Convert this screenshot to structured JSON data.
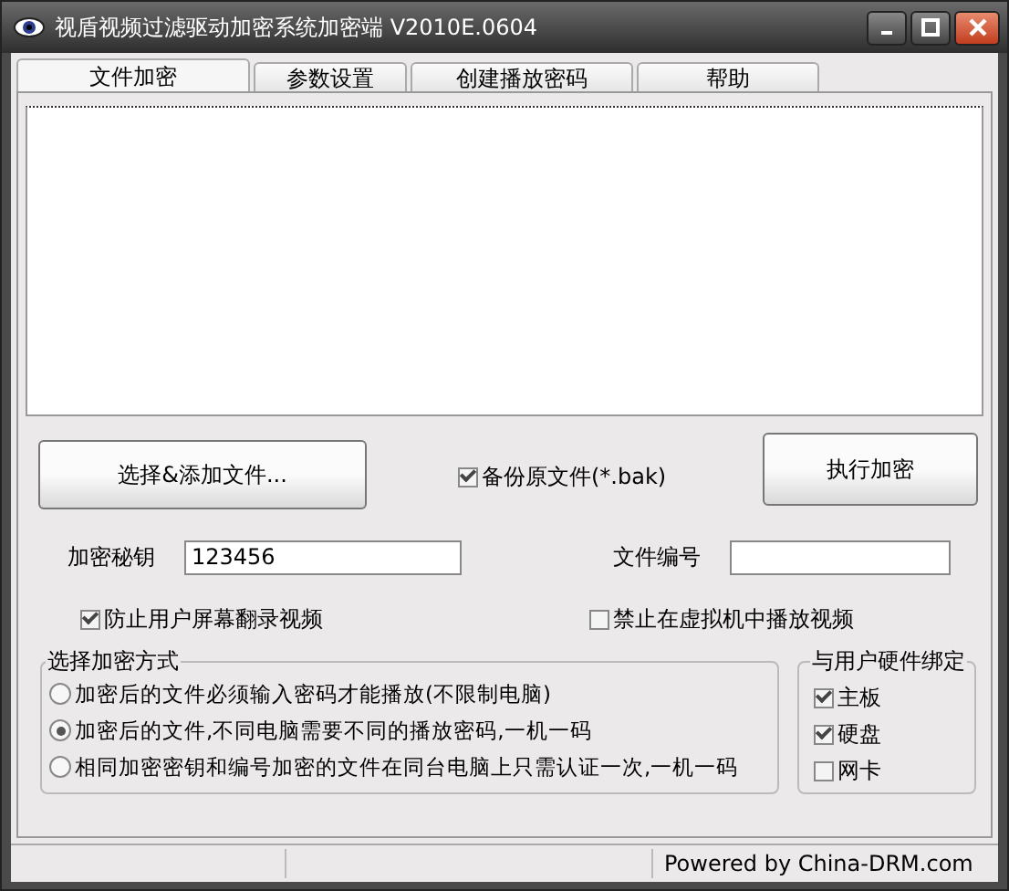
{
  "window": {
    "title": "视盾视频过滤驱动加密系统加密端 V2010E.0604"
  },
  "tabs": [
    {
      "label": "文件加密",
      "selected": true
    },
    {
      "label": "参数设置",
      "selected": false
    },
    {
      "label": "创建播放密码",
      "selected": false
    },
    {
      "label": "帮助",
      "selected": false
    }
  ],
  "add_button": "选择&添加文件...",
  "backup": {
    "label": "备份原文件(*.bak)",
    "checked": true
  },
  "encrypt_button": "执行加密",
  "key_field": {
    "label": "加密秘钥",
    "value": "123456"
  },
  "number_field": {
    "label": "文件编号"
  },
  "prevent_capture": {
    "label": "防止用户屏幕翻录视频",
    "checked": true
  },
  "block_vm": {
    "label": "禁止在虚拟机中播放视频",
    "checked": false
  },
  "mode_group": {
    "title": "选择加密方式",
    "options": [
      {
        "label": "加密后的文件必须输入密码才能播放(不限制电脑)",
        "selected": false
      },
      {
        "label": "加密后的文件,不同电脑需要不同的播放密码,一机一码",
        "selected": true
      },
      {
        "label": "相同加密密钥和编号加密的文件在同台电脑上只需认证一次,一机一码",
        "selected": false
      }
    ]
  },
  "hardware_group": {
    "title": "与用户硬件绑定",
    "options": [
      {
        "label": "主板",
        "checked": true
      },
      {
        "label": "硬盘",
        "checked": true
      },
      {
        "label": "网卡",
        "checked": false
      }
    ]
  },
  "status_bar": "Powered by China-DRM.com"
}
